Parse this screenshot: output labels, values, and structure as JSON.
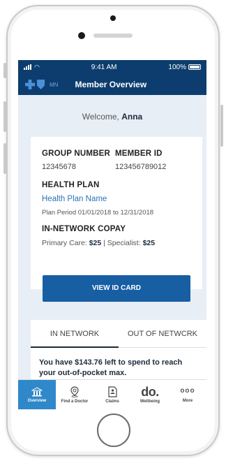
{
  "status": {
    "time": "9:41 AM",
    "battery": "100%"
  },
  "header": {
    "state": "MN",
    "title": "Member Overview"
  },
  "welcome": {
    "greeting": "Welcome,",
    "name": "Anna"
  },
  "card": {
    "group_label": "GROUP NUMBER",
    "group_value": "12345678",
    "member_label": "MEMBER ID",
    "member_value": "123456789012",
    "plan_label": "HEALTH PLAN",
    "plan_name": "Health Plan Name",
    "plan_period": "Plan Period  01/01/2018 to 12/31/2018",
    "copay_label": "IN-NETWORK COPAY",
    "primary_label": "Primary Care: ",
    "primary_value": "$25",
    "specialist_label": " | Specialist: ",
    "specialist_value": "$25",
    "button": "VIEW ID CARD"
  },
  "network": {
    "tabs": [
      "IN NETWORK",
      "OUT OF NETWCRK"
    ],
    "message": "You have $143.76 left to spend to reach your out-of-pocket max."
  },
  "nav": [
    {
      "label": "Overview",
      "icon": "building-icon",
      "active": true
    },
    {
      "label": "Find a Doctor",
      "icon": "location-pin-icon"
    },
    {
      "label": "Claims",
      "icon": "claims-document-icon"
    },
    {
      "label": "Wellbeing",
      "icon": "do.",
      "glyph": "do."
    },
    {
      "label": "More",
      "icon": "more-dots-icon",
      "glyph": "ooo"
    }
  ],
  "colors": {
    "primary": "#0c3d6e",
    "accent": "#175ea3",
    "link": "#2a74b8",
    "nav_active": "#2f88c9"
  }
}
